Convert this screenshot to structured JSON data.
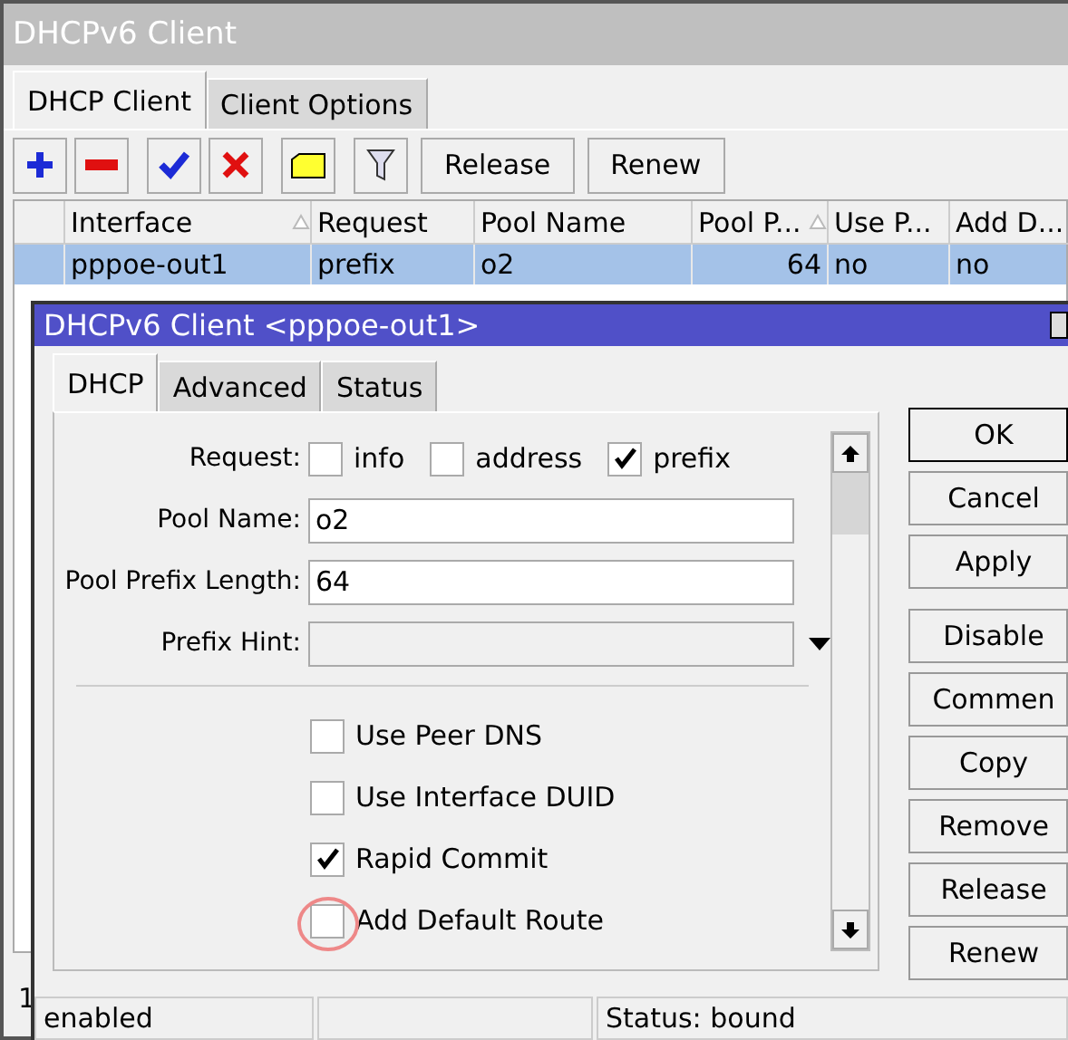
{
  "window": {
    "title": "DHCPv6 Client"
  },
  "tabs": [
    {
      "label": "DHCP Client",
      "selected": true
    },
    {
      "label": "Client Options",
      "selected": false
    }
  ],
  "toolbar": {
    "buttons": [
      "Release",
      "Renew"
    ]
  },
  "table": {
    "columns": [
      {
        "label": "Interface",
        "sorted": true
      },
      {
        "label": "Request",
        "sorted": false
      },
      {
        "label": "Pool Name",
        "sorted": false
      },
      {
        "label": "Pool P...",
        "sorted": true
      },
      {
        "label": "Use P...",
        "sorted": false
      },
      {
        "label": "Add D...",
        "sorted": false
      }
    ],
    "rows": [
      {
        "selected": true,
        "cells": [
          "pppoe-out1",
          "prefix",
          "o2",
          "64",
          "no",
          "no"
        ]
      }
    ]
  },
  "status_bar": {
    "count": "1"
  },
  "dialog": {
    "title": "DHCPv6 Client <pppoe-out1>",
    "tabs": [
      {
        "label": "DHCP",
        "selected": true
      },
      {
        "label": "Advanced",
        "selected": false
      },
      {
        "label": "Status",
        "selected": false
      }
    ],
    "request": {
      "label": "Request:",
      "options": [
        {
          "label": "info",
          "checked": false
        },
        {
          "label": "address",
          "checked": false
        },
        {
          "label": "prefix",
          "checked": true
        }
      ]
    },
    "fields": [
      {
        "kind": "text",
        "label": "Pool Name:",
        "value": "o2"
      },
      {
        "kind": "text",
        "label": "Pool Prefix Length:",
        "value": "64"
      },
      {
        "kind": "dropdown",
        "label": "Prefix Hint:"
      }
    ],
    "checkboxes": [
      {
        "label": "Use Peer DNS",
        "checked": false
      },
      {
        "label": "Use Interface DUID",
        "checked": false
      },
      {
        "label": "Rapid Commit",
        "checked": true
      },
      {
        "label": "Add Default Route",
        "checked": false,
        "circled": true
      }
    ],
    "buttons": [
      {
        "label": "OK",
        "default": true
      },
      {
        "label": "Cancel",
        "default": false
      },
      {
        "label": "Apply",
        "default": false
      },
      {
        "label": "Disable",
        "default": false,
        "gap": true
      },
      {
        "label": "Commen",
        "default": false
      },
      {
        "label": "Copy",
        "default": false
      },
      {
        "label": "Remove",
        "default": false
      },
      {
        "label": "Release",
        "default": false
      },
      {
        "label": "Renew",
        "default": false
      }
    ],
    "status_bar": {
      "state": "enabled",
      "status": "Status: bound"
    }
  }
}
